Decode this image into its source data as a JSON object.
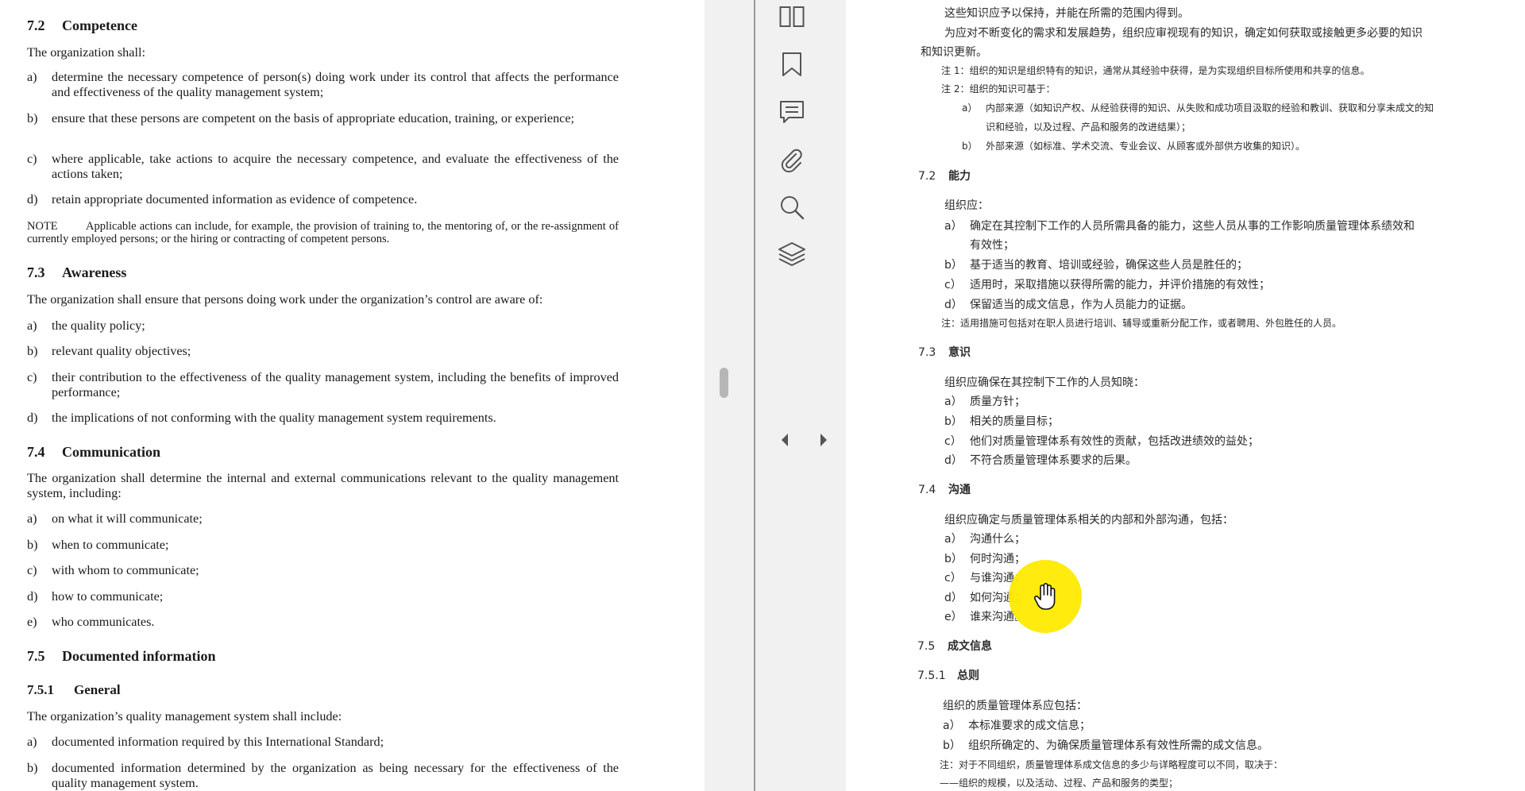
{
  "english_doc": {
    "s72": {
      "num": "7.2",
      "title": "Competence",
      "intro": "The organization shall:",
      "items": [
        {
          "label": "a)",
          "text": "determine the necessary competence of person(s) doing work under its control that affects the performance and effectiveness of the quality management system;"
        },
        {
          "label": "b)",
          "text": "ensure that these persons are competent on the basis of appropriate education, training, or experience;"
        },
        {
          "label": "c)",
          "text": "where applicable, take actions to acquire the necessary competence, and evaluate the effectiveness of the actions taken;"
        },
        {
          "label": "d)",
          "text": "retain appropriate documented information as evidence of competence."
        }
      ],
      "note_label": "NOTE",
      "note_text": "Applicable actions can include, for example, the provision of training to, the mentoring of, or the re-assignment of currently employed persons; or the hiring or contracting of competent persons."
    },
    "s73": {
      "num": "7.3",
      "title": "Awareness",
      "intro": "The organization shall ensure that persons doing work under the organization’s control are aware of:",
      "items": [
        {
          "label": "a)",
          "text": "the quality policy;"
        },
        {
          "label": "b)",
          "text": "relevant quality objectives;"
        },
        {
          "label": "c)",
          "text": "their contribution to the effectiveness of the quality management system, including the benefits of improved performance;"
        },
        {
          "label": "d)",
          "text": "the implications of not conforming with the quality management system requirements."
        }
      ]
    },
    "s74": {
      "num": "7.4",
      "title": "Communication",
      "intro": "The organization shall determine the internal and external communications relevant to the quality management system, including:",
      "items": [
        {
          "label": "a)",
          "text": "on what it will communicate;"
        },
        {
          "label": "b)",
          "text": "when to communicate;"
        },
        {
          "label": "c)",
          "text": "with whom to communicate;"
        },
        {
          "label": "d)",
          "text": "how to communicate;"
        },
        {
          "label": "e)",
          "text": "who communicates."
        }
      ]
    },
    "s75": {
      "num": "7.5",
      "title": "Documented information"
    },
    "s751": {
      "num": "7.5.1",
      "title": "General",
      "intro": "The organization’s quality management system shall include:",
      "items": [
        {
          "label": "a)",
          "text": "documented information required by this International Standard;"
        },
        {
          "label": "b)",
          "text": "documented information determined by the organization as being necessary for the effectiveness of the quality management system."
        }
      ]
    }
  },
  "toolbar": {
    "icons": [
      "two-page-view-icon",
      "bookmark-icon",
      "comment-icon",
      "attachment-icon",
      "search-icon",
      "layers-icon"
    ],
    "arrows": [
      "collapse-left-arrow-icon",
      "expand-right-arrow-icon"
    ]
  },
  "chinese_doc": {
    "top": {
      "line1": "这些知识应予以保持，并能在所需的范围内得到。",
      "line2": "为应对不断变化的需求和发展趋势，组织应审视现有的知识，确定如何获取或接触更多必要的知识",
      "line3": "和知识更新。",
      "note1": "注 1：组织的知识是组织特有的知识，通常从其经验中获得，是为实现组织目标所使用和共享的信息。",
      "note2": "注 2：组织的知识可基于：",
      "note2a_label": "a）",
      "note2a_1": "内部来源（如知识产权、从经验获得的知识、从失败和成功项目汲取的经验和教训、获取和分享未成文的知",
      "note2a_2": "识和经验，以及过程、产品和服务的改进结果）；",
      "note2b_label": "b）",
      "note2b": "外部来源（如标准、学术交流、专业会议、从顾客或外部供方收集的知识）。"
    },
    "s72": {
      "num": "7.2",
      "title": "能力",
      "intro": "组织应：",
      "a_label": "a）",
      "a_1": "确定在其控制下工作的人员所需具备的能力，这些人员从事的工作影响质量管理体系绩效和",
      "a_2": "有效性；",
      "b_label": "b）",
      "b": "基于适当的教育、培训或经验，确保这些人员是胜任的；",
      "c_label": "c）",
      "c": "适用时，采取措施以获得所需的能力，并评价措施的有效性；",
      "d_label": "d）",
      "d": "保留适当的成文信息，作为人员能力的证据。",
      "note": "注：适用措施可包括对在职人员进行培训、辅导或重新分配工作，或者聘用、外包胜任的人员。"
    },
    "s73": {
      "num": "7.3",
      "title": "意识",
      "intro": "组织应确保在其控制下工作的人员知晓：",
      "a_label": "a）",
      "a": "质量方针；",
      "b_label": "b）",
      "b": "相关的质量目标；",
      "c_label": "c）",
      "c": "他们对质量管理体系有效性的贡献，包括改进绩效的益处；",
      "d_label": "d）",
      "d": "不符合质量管理体系要求的后果。"
    },
    "s74": {
      "num": "7.4",
      "title": "沟通",
      "intro": "组织应确定与质量管理体系相关的内部和外部沟通，包括：",
      "a_label": "a）",
      "a": "沟通什么；",
      "b_label": "b）",
      "b": "何时沟通；",
      "c_label": "c）",
      "c": "与谁沟通；",
      "d_label": "d）",
      "d": "如何沟通；",
      "e_label": "e）",
      "e": "谁来沟通。"
    },
    "s75": {
      "num": "7.5",
      "title": "成文信息"
    },
    "s751": {
      "num": "7.5.1",
      "title": "总则",
      "intro": "组织的质量管理体系应包括：",
      "a_label": "a）",
      "a": "本标准要求的成文信息；",
      "b_label": "b）",
      "b": "组织所确定的、为确保质量管理体系有效性所需的成文信息。",
      "note": "注：对于不同组织，质量管理体系成文信息的多少与详略程度可以不同，取决于：",
      "dash": "——组织的规模，以及活动、过程、产品和服务的类型；"
    }
  },
  "cursor": {
    "icon": "hand-cursor-icon",
    "highlight_color": "#ffea00"
  }
}
